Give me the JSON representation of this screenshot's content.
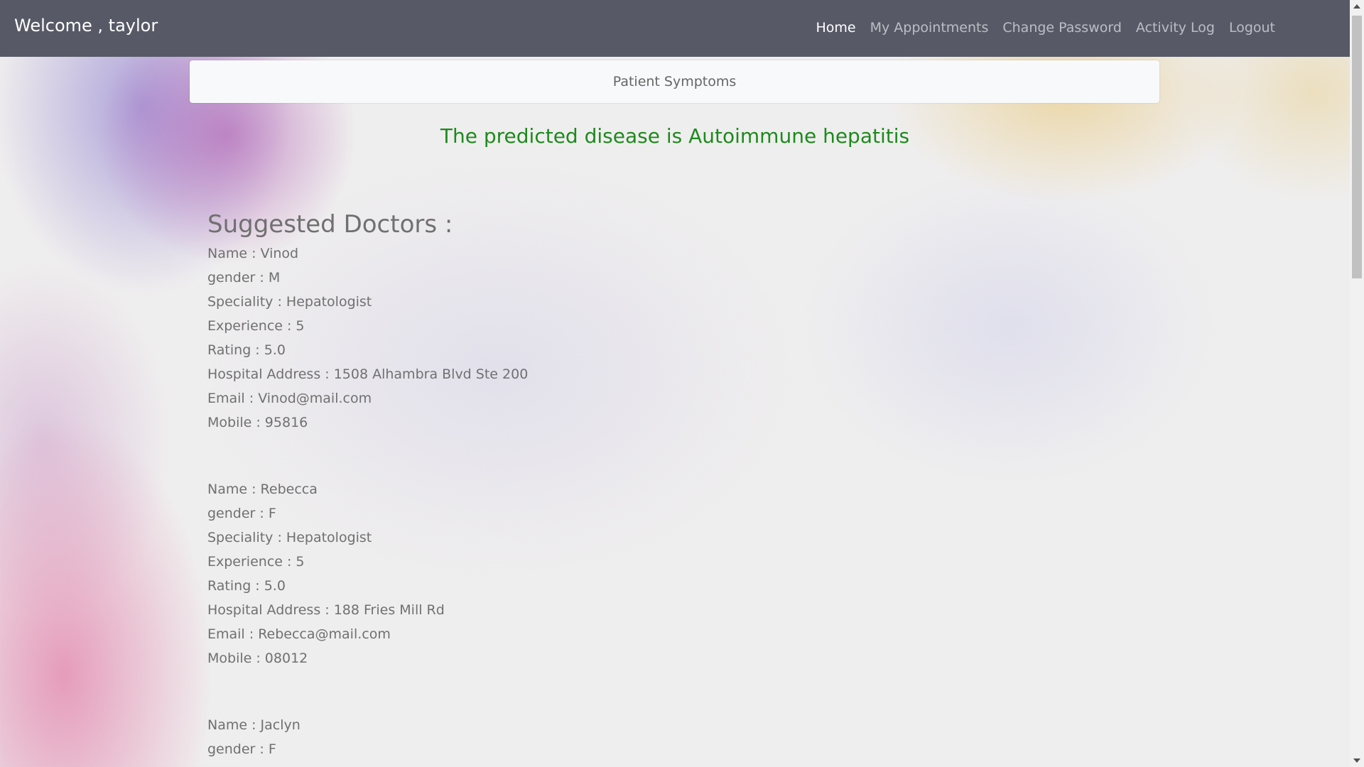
{
  "navbar": {
    "welcome": "Welcome , taylor",
    "links": [
      {
        "label": "Home",
        "active": true
      },
      {
        "label": "My Appointments",
        "active": false
      },
      {
        "label": "Change Password",
        "active": false
      },
      {
        "label": "Activity Log",
        "active": false
      },
      {
        "label": "Logout",
        "active": false
      }
    ]
  },
  "symptoms_bar": {
    "label": "Patient Symptoms"
  },
  "prediction": {
    "text": "The predicted disease is Autoimmune hepatitis",
    "color": "#1d8a1d"
  },
  "doctors": {
    "heading": "Suggested Doctors :",
    "list": [
      {
        "name": "Name : Vinod",
        "gender": "gender : M",
        "speciality": "Speciality : Hepatologist",
        "experience": "Experience : 5",
        "rating": "Rating : 5.0",
        "address": "Hospital Address : 1508 Alhambra Blvd Ste 200",
        "email": "Email : Vinod@mail.com",
        "mobile": "Mobile : 95816"
      },
      {
        "name": "Name : Rebecca",
        "gender": "gender : F",
        "speciality": "Speciality : Hepatologist",
        "experience": "Experience : 5",
        "rating": "Rating : 5.0",
        "address": "Hospital Address : 188 Fries Mill Rd",
        "email": "Email : Rebecca@mail.com",
        "mobile": "Mobile : 08012"
      },
      {
        "name": "Name : Jaclyn",
        "gender": "gender : F"
      }
    ]
  },
  "colors": {
    "navbar_bg": "#575a66",
    "prediction_text": "#1d8a1d",
    "doctor_text": "#707070"
  },
  "icons": [
    "scroll-up-arrow-icon",
    "scroll-down-arrow-icon"
  ]
}
